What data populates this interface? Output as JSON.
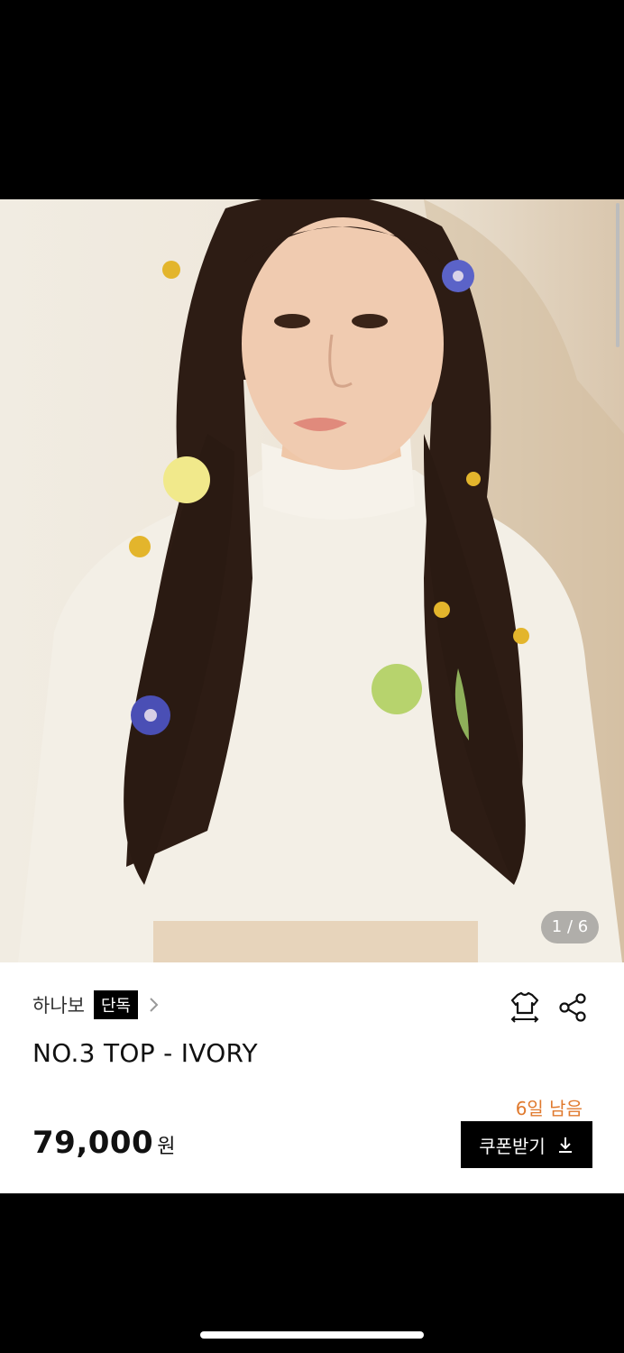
{
  "product": {
    "image_counter": "1 / 6",
    "brand": "하나보",
    "exclusive_badge": "단독",
    "title": "NO.3 TOP - IVORY",
    "price": "79,000",
    "currency": "원",
    "coupon": {
      "days_left": "6일 남음",
      "label": "쿠폰받기"
    }
  },
  "icons": [
    "chevron-right-icon",
    "size-guide-shirt-icon",
    "share-icon",
    "download-icon"
  ],
  "colors": {
    "accent_orange": "#e07a2e",
    "badge_black": "#000000"
  }
}
